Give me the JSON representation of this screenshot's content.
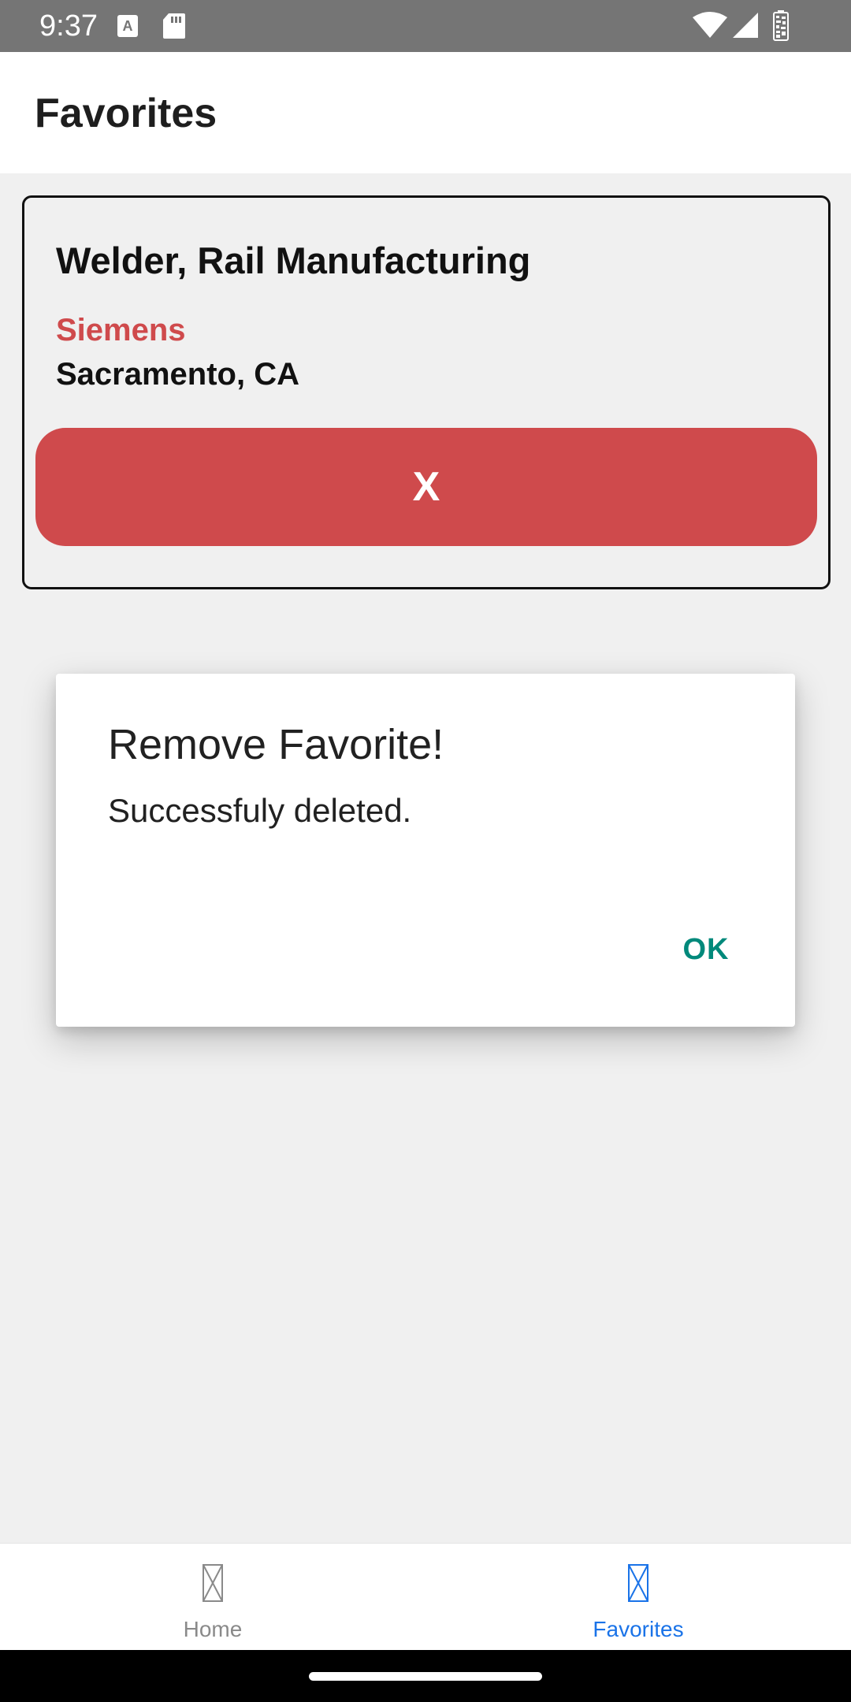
{
  "status_bar": {
    "time": "9:37",
    "icons": [
      "keyboard-a-icon",
      "sd-card-icon",
      "wifi-icon",
      "signal-icon",
      "battery-icon"
    ]
  },
  "app_bar": {
    "title": "Favorites"
  },
  "favorite_card": {
    "title": "Welder, Rail Manufacturing",
    "company": "Siemens",
    "location": "Sacramento, CA",
    "remove_label": "X"
  },
  "dialog": {
    "title": "Remove Favorite!",
    "message": "Successfuly deleted.",
    "ok_label": "OK"
  },
  "bottom_nav": {
    "items": [
      {
        "label": "Home",
        "icon": "home-icon",
        "active": false
      },
      {
        "label": "Favorites",
        "icon": "favorites-icon",
        "active": true
      }
    ]
  },
  "colors": {
    "accent_red": "#cf4a4c",
    "dialog_button": "#00897b",
    "nav_active": "#1a73e8",
    "nav_inactive": "#8a8a8a",
    "status_bar": "#757575"
  }
}
